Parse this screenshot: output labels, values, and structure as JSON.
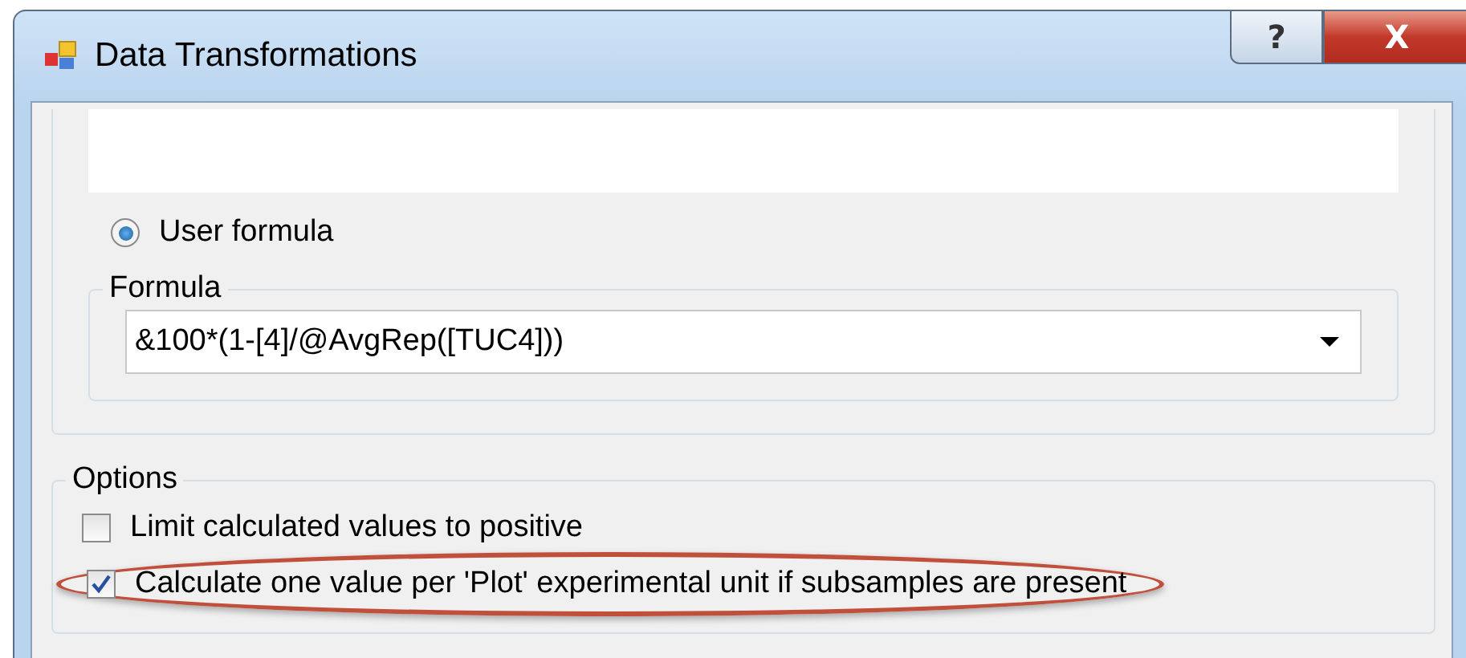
{
  "window": {
    "title": "Data Transformations",
    "buttons": [
      {
        "kind": "help",
        "label": "?"
      },
      {
        "kind": "close",
        "label": "X"
      }
    ]
  },
  "method": {
    "label": "User formula",
    "selected": true
  },
  "formula": {
    "label": "Formula",
    "value": "&100*(1-[4]/@AvgRep([TUC4]))"
  },
  "options": {
    "label": "Options",
    "items": [
      {
        "label": "Limit calculated values to positive",
        "checked": false,
        "highlighted": false
      },
      {
        "label": "Calculate one value per 'Plot' experimental unit if subsamples are present",
        "checked": true,
        "highlighted": true
      }
    ]
  }
}
